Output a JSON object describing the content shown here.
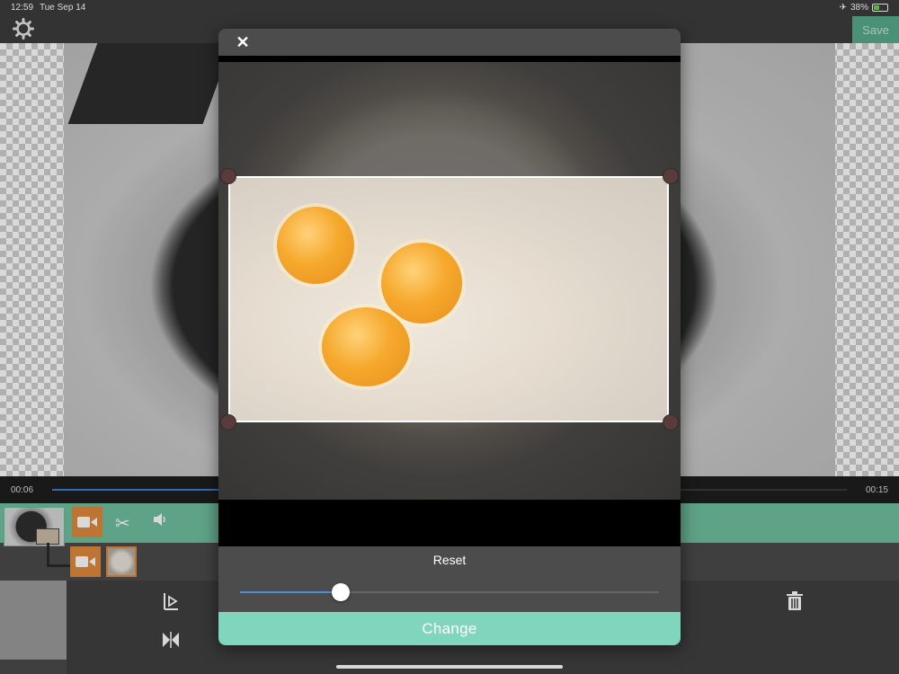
{
  "status_bar": {
    "time": "12:59",
    "date": "Tue Sep 14",
    "battery": "38%"
  },
  "toolbar": {
    "save_label": "Save"
  },
  "timeline": {
    "current_time": "00:06",
    "end_time": "00:15",
    "progress": 0.4
  },
  "modal": {
    "close_label": "✕",
    "reset_label": "Reset",
    "change_label": "Change",
    "slider_value": 0.24
  },
  "icons": {
    "settings": "gear-icon",
    "close": "close-icon",
    "video_camera": "video-camera-icon",
    "scissors": "scissors-icon",
    "volume": "volume-icon",
    "split": "split-icon",
    "mirror": "mirror-icon",
    "trash": "trash-icon"
  },
  "colors": {
    "accent": "#7fd6bc",
    "save": "#5fbf9a",
    "clip": "#e0893b",
    "progress": "#4a90e2"
  }
}
